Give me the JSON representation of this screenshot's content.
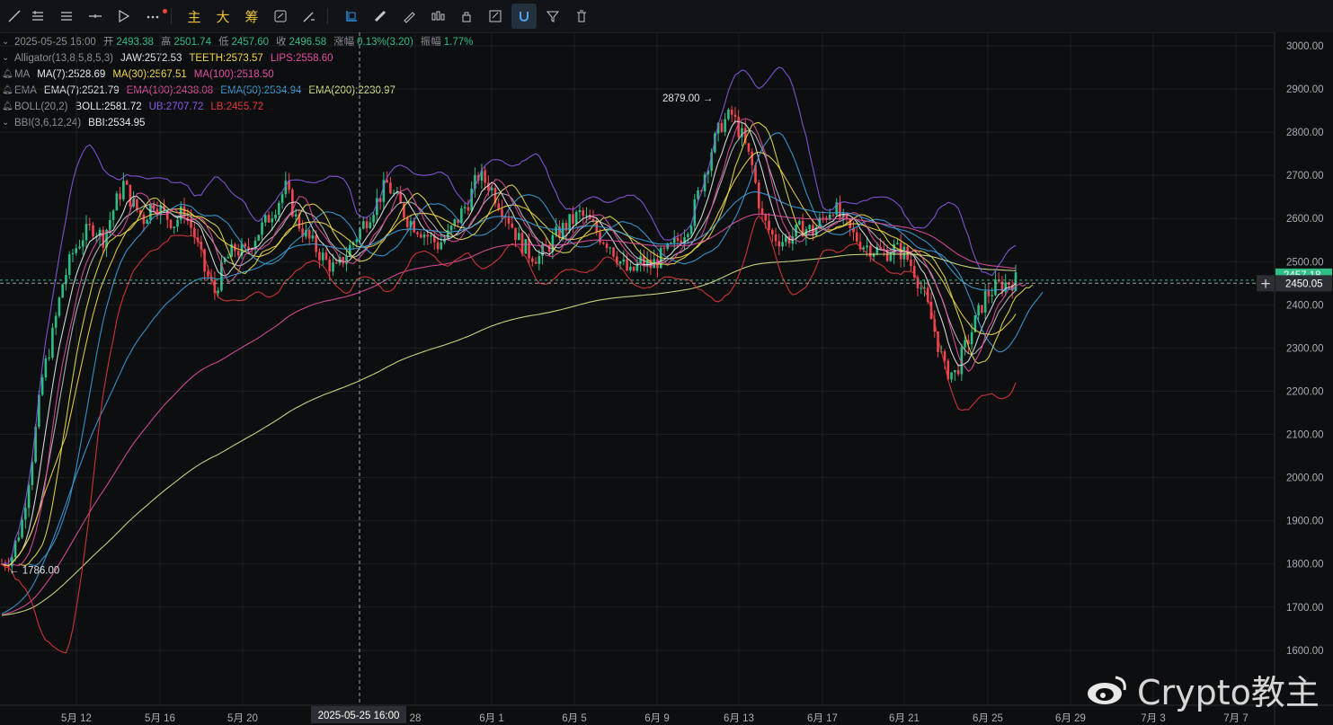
{
  "toolbar": {
    "tools": [
      {
        "icon": "trend-line-icon"
      },
      {
        "icon": "horizontal-lines-icon"
      },
      {
        "icon": "parallel-lines-icon"
      },
      {
        "icon": "cross-line-icon"
      },
      {
        "icon": "fib-arrow-icon"
      },
      {
        "icon": "more-icon"
      },
      {
        "icon": "main-chart-label",
        "label": "主"
      },
      {
        "icon": "large-label",
        "label": "大"
      },
      {
        "icon": "chips-label",
        "label": "筹"
      },
      {
        "icon": "replay-icon"
      },
      {
        "icon": "measure-icon"
      },
      {
        "icon": "rectangle-select-icon"
      },
      {
        "icon": "ruler-icon"
      },
      {
        "icon": "pencil-icon"
      },
      {
        "icon": "candles-icon"
      },
      {
        "icon": "lock-icon"
      },
      {
        "icon": "edit-note-icon"
      },
      {
        "icon": "magnet-icon"
      },
      {
        "icon": "filter-icon"
      },
      {
        "icon": "trash-icon"
      }
    ]
  },
  "legend": {
    "ohlc": {
      "date": "2025-05-25 16:00",
      "open_label": "开",
      "open": "2493.38",
      "high_label": "高",
      "high": "2501.74",
      "low_label": "低",
      "low": "2457.60",
      "close_label": "收",
      "close": "2496.58",
      "change_label": "涨幅",
      "change": "0.13%(3.20)",
      "amp_label": "振幅",
      "amp": "1.77%"
    },
    "alligator": {
      "name": "Alligator(13,8,5,8,5,3)",
      "jaw": "JAW:2572.53",
      "teeth": "TEETH:2573.57",
      "lips": "LIPS:2558.60"
    },
    "ma": {
      "name": "MA",
      "ma7": "MA(7):2528.69",
      "ma30": "MA(30):2567.51",
      "ma100": "MA(100):2518.50"
    },
    "ema": {
      "name": "EMA",
      "ema7": "EMA(7):2521.79",
      "ema100": "EMA(100):2438.08",
      "ema50": "EMA(50):2534.94",
      "ema200": "EMA(200):2230.97"
    },
    "boll": {
      "name": "BOLL(20,2)",
      "boll": "BOLL:2581.72",
      "ub": "UB:2707.72",
      "lb": "LB:2455.72"
    },
    "bbi": {
      "name": "BBI(3,6,12,24)",
      "bbi": "BBI:2534.95"
    }
  },
  "colors": {
    "up": "#2ebd85",
    "down": "#f0464f",
    "jaw": "#3ca0dc",
    "teeth": "#e6e04a",
    "lips": "#e0509a",
    "ma7": "#e8e8e8",
    "ma30": "#f2d64b",
    "ma100": "#e050a0",
    "ema200": "#d6e68a",
    "ub": "#8a5ae6",
    "lb": "#e0393e",
    "bbi": "#d0d0d0"
  },
  "crosshair": {
    "x_label": "2025-05-25 16:00",
    "y_label": "2450.05"
  },
  "last_price_label": "2457.18",
  "watermark": "Crypto教主",
  "chart_data": {
    "type": "candlestick",
    "y_ticks": [
      "3000.00",
      "2900.00",
      "2800.00",
      "2700.00",
      "2600.00",
      "2500.00",
      "2400.00",
      "2300.00",
      "2200.00",
      "2100.00",
      "2000.00",
      "1900.00",
      "1800.00",
      "1700.00",
      "1600.00"
    ],
    "ylim": [
      1530,
      3040
    ],
    "x_ticks": [
      "5月 12",
      "5月 16",
      "5月 20",
      "28",
      "6月 1",
      "6月 5",
      "6月 9",
      "6月 13",
      "6月 17",
      "6月 21",
      "6月 25",
      "6月 29",
      "7月 3",
      "7月 7"
    ],
    "annotations": [
      {
        "text": "2879.00",
        "value": 2879
      },
      {
        "text": "1786.00",
        "value": 1786
      }
    ],
    "close_path": [
      [
        0,
        1800
      ],
      [
        3,
        1820
      ],
      [
        6,
        1900
      ],
      [
        9,
        2050
      ],
      [
        12,
        2230
      ],
      [
        15,
        2330
      ],
      [
        18,
        2450
      ],
      [
        21,
        2520
      ],
      [
        24,
        2560
      ],
      [
        27,
        2580
      ],
      [
        30,
        2555
      ],
      [
        33,
        2620
      ],
      [
        36,
        2680
      ],
      [
        39,
        2630
      ],
      [
        42,
        2600
      ],
      [
        45,
        2640
      ],
      [
        48,
        2610
      ],
      [
        51,
        2590
      ],
      [
        54,
        2620
      ],
      [
        57,
        2560
      ],
      [
        60,
        2480
      ],
      [
        63,
        2430
      ],
      [
        66,
        2500
      ],
      [
        69,
        2530
      ],
      [
        72,
        2520
      ],
      [
        75,
        2560
      ],
      [
        78,
        2590
      ],
      [
        81,
        2630
      ],
      [
        84,
        2670
      ],
      [
        87,
        2600
      ],
      [
        90,
        2560
      ],
      [
        93,
        2530
      ],
      [
        96,
        2500
      ],
      [
        99,
        2480
      ],
      [
        102,
        2520
      ],
      [
        105,
        2560
      ],
      [
        108,
        2600
      ],
      [
        111,
        2640
      ],
      [
        114,
        2680
      ],
      [
        117,
        2640
      ],
      [
        120,
        2600
      ],
      [
        123,
        2580
      ],
      [
        126,
        2560
      ],
      [
        129,
        2540
      ],
      [
        132,
        2560
      ],
      [
        135,
        2600
      ],
      [
        138,
        2640
      ],
      [
        141,
        2700
      ],
      [
        144,
        2680
      ],
      [
        147,
        2640
      ],
      [
        150,
        2600
      ],
      [
        153,
        2550
      ],
      [
        156,
        2520
      ],
      [
        159,
        2510
      ],
      [
        162,
        2540
      ],
      [
        165,
        2570
      ],
      [
        168,
        2590
      ],
      [
        171,
        2610
      ],
      [
        174,
        2590
      ],
      [
        177,
        2560
      ],
      [
        180,
        2540
      ],
      [
        183,
        2500
      ],
      [
        186,
        2470
      ],
      [
        189,
        2500
      ],
      [
        192,
        2490
      ],
      [
        195,
        2510
      ],
      [
        198,
        2530
      ],
      [
        201,
        2560
      ],
      [
        204,
        2600
      ],
      [
        207,
        2680
      ],
      [
        210,
        2760
      ],
      [
        213,
        2820
      ],
      [
        216,
        2840
      ],
      [
        219,
        2790
      ],
      [
        222,
        2720
      ],
      [
        225,
        2600
      ],
      [
        228,
        2560
      ],
      [
        231,
        2550
      ],
      [
        234,
        2560
      ],
      [
        237,
        2580
      ],
      [
        240,
        2570
      ],
      [
        243,
        2600
      ],
      [
        246,
        2630
      ],
      [
        249,
        2590
      ],
      [
        252,
        2560
      ],
      [
        255,
        2540
      ],
      [
        258,
        2530
      ],
      [
        261,
        2520
      ],
      [
        264,
        2530
      ],
      [
        267,
        2520
      ],
      [
        270,
        2480
      ],
      [
        273,
        2420
      ],
      [
        276,
        2340
      ],
      [
        279,
        2250
      ],
      [
        282,
        2240
      ],
      [
        285,
        2300
      ],
      [
        288,
        2360
      ],
      [
        291,
        2420
      ],
      [
        294,
        2440
      ],
      [
        297,
        2450
      ],
      [
        300,
        2457
      ]
    ],
    "series": [
      {
        "name": "MA(7)",
        "values_at_end": 2528.69
      },
      {
        "name": "MA(30)",
        "values_at_end": 2567.51
      },
      {
        "name": "MA(100)",
        "values_at_end": 2518.5
      },
      {
        "name": "EMA(200)",
        "values_at_end": 2230.97
      },
      {
        "name": "UB",
        "values_at_end": 2707.72
      },
      {
        "name": "LB",
        "values_at_end": 2455.72
      }
    ]
  }
}
